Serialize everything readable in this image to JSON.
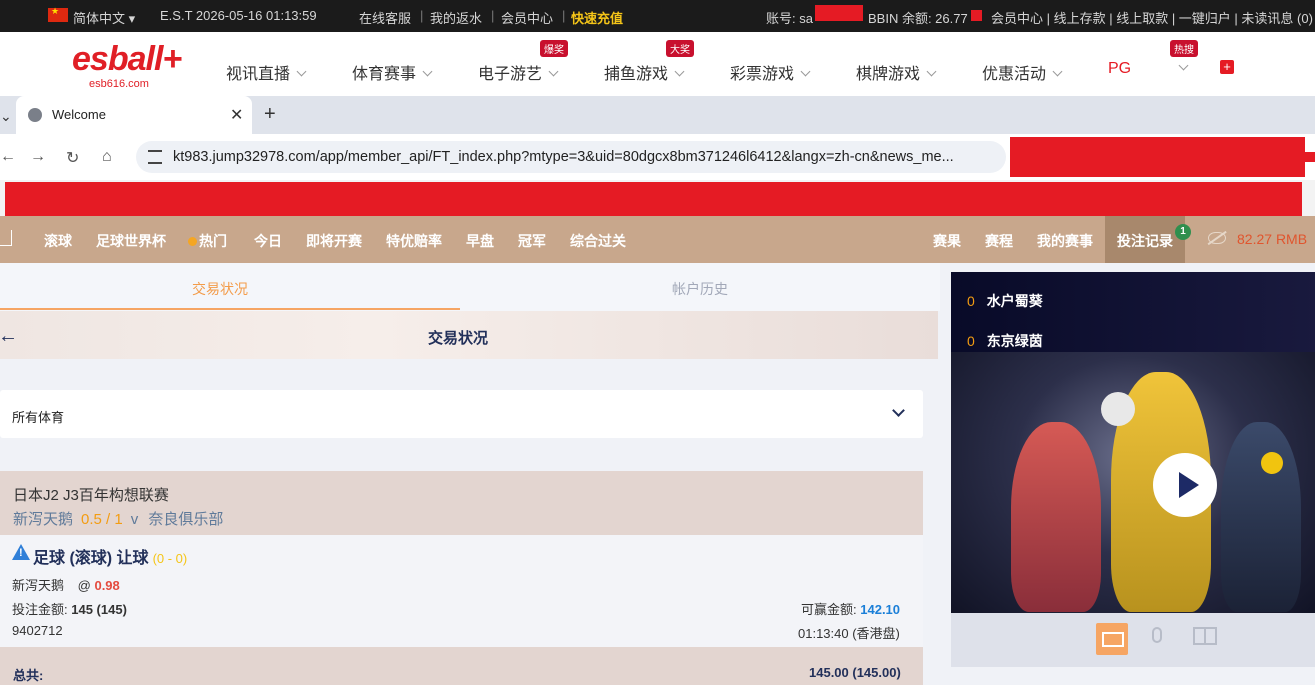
{
  "topbar": {
    "language": "简体中文",
    "datetime": "E.S.T 2026-05-16 01:13:59",
    "links": [
      "在线客服",
      "我的返水",
      "会员中心"
    ],
    "quick_deposit": "快速充值",
    "account_label": "账号: sa",
    "balance_label": "BBIN 余额: 26.77",
    "right_links": "会员中心 | 线上存款 | 线上取款 | 一键归户 | 未读讯息 (0)"
  },
  "logo": {
    "brand": "esball+",
    "url": "esb616.com"
  },
  "mainnav": {
    "items": [
      {
        "label": "视讯直播"
      },
      {
        "label": "体育赛事"
      },
      {
        "label": "电子游艺",
        "tag": "爆奖"
      },
      {
        "label": "捕鱼游戏",
        "tag": "大奖"
      },
      {
        "label": "彩票游戏"
      },
      {
        "label": "棋牌游戏"
      },
      {
        "label": "优惠活动"
      },
      {
        "label": "PG"
      },
      {
        "label": "",
        "tag": "热搜"
      }
    ],
    "pg_color": "#e51b24"
  },
  "browser": {
    "tab_title": "Welcome",
    "url": "kt983.jump32978.com/app/member_api/FT_index.php?mtype=3&uid=80dgcx8bm371246l6412&langx=zh-cn&news_me..."
  },
  "sportnav": {
    "left": [
      "滚球",
      "足球世界杯",
      "热门",
      "今日",
      "即将开赛",
      "特优赔率",
      "早盘",
      "冠军",
      "综合过关"
    ],
    "right": [
      "赛果",
      "赛程",
      "我的赛事",
      "投注记录"
    ],
    "badge": "1",
    "balance": "82.27",
    "currency": "RMB"
  },
  "subtabs": {
    "active": "交易状况",
    "inactive": "帐户历史"
  },
  "banner_title": "交易状况",
  "sport_filter": "所有体育",
  "ticket": {
    "league": "日本J2 J3百年构想联赛",
    "home": "新泻天鹅",
    "handicap": "0.5 / 1",
    "vs": "v",
    "away": "奈良俱乐部",
    "bet_type": "足球 (滚球) 让球",
    "bet_score": "(0 - 0)",
    "selection": "新泻天鹅",
    "at": "@",
    "odds": "0.98",
    "stake_label": "投注金额:",
    "stake": "145 (145)",
    "win_label": "可赢金额:",
    "win": "142.10",
    "ticket_id": "9402712",
    "time": "01:13:40 (香港盘)",
    "total_label": "总共:",
    "total": "145.00 (145.00)"
  },
  "video": {
    "teams": [
      {
        "score": "0",
        "name": "水户蜀葵"
      },
      {
        "score": "0",
        "name": "东京绿茵"
      }
    ]
  }
}
